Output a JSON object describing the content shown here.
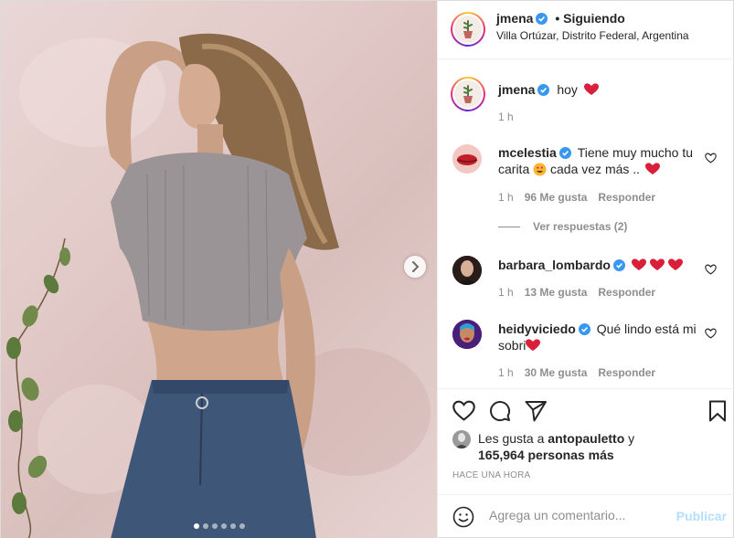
{
  "post": {
    "author": "jmena",
    "follow_status": "• Siguiendo",
    "location": "Villa Ortúzar, Distrito Federal, Argentina",
    "caption": "hoy",
    "caption_time": "1 h",
    "carousel": {
      "slides": 6,
      "active_index": 0
    }
  },
  "comments": [
    {
      "user": "mcelestia",
      "text_line1": "Tiene muy mucho tu",
      "text_line2": "carita",
      "text_line2b": "cada vez más ..",
      "time": "1 h",
      "likes": "96 Me gusta",
      "reply": "Responder",
      "view_replies": "Ver respuestas (2)"
    },
    {
      "user": "barbara_lombardo",
      "time": "1 h",
      "likes": "13 Me gusta",
      "reply": "Responder"
    },
    {
      "user": "heidyviciedo",
      "text_line1": "Qué lindo está mi",
      "text_line2": "sobri",
      "time": "1 h",
      "likes": "30 Me gusta",
      "reply": "Responder"
    }
  ],
  "likes": {
    "prefix": "Les gusta a",
    "liker": "antopauletto",
    "joiner": "y",
    "count": "165,964 personas más"
  },
  "timestamp": "HACE UNA HORA",
  "comment_box": {
    "placeholder": "Agrega un comentario...",
    "publish": "Publicar"
  },
  "colors": {
    "verified": "#3897f0",
    "heart": "#ed4956",
    "link_disabled": "#b2dffc"
  }
}
